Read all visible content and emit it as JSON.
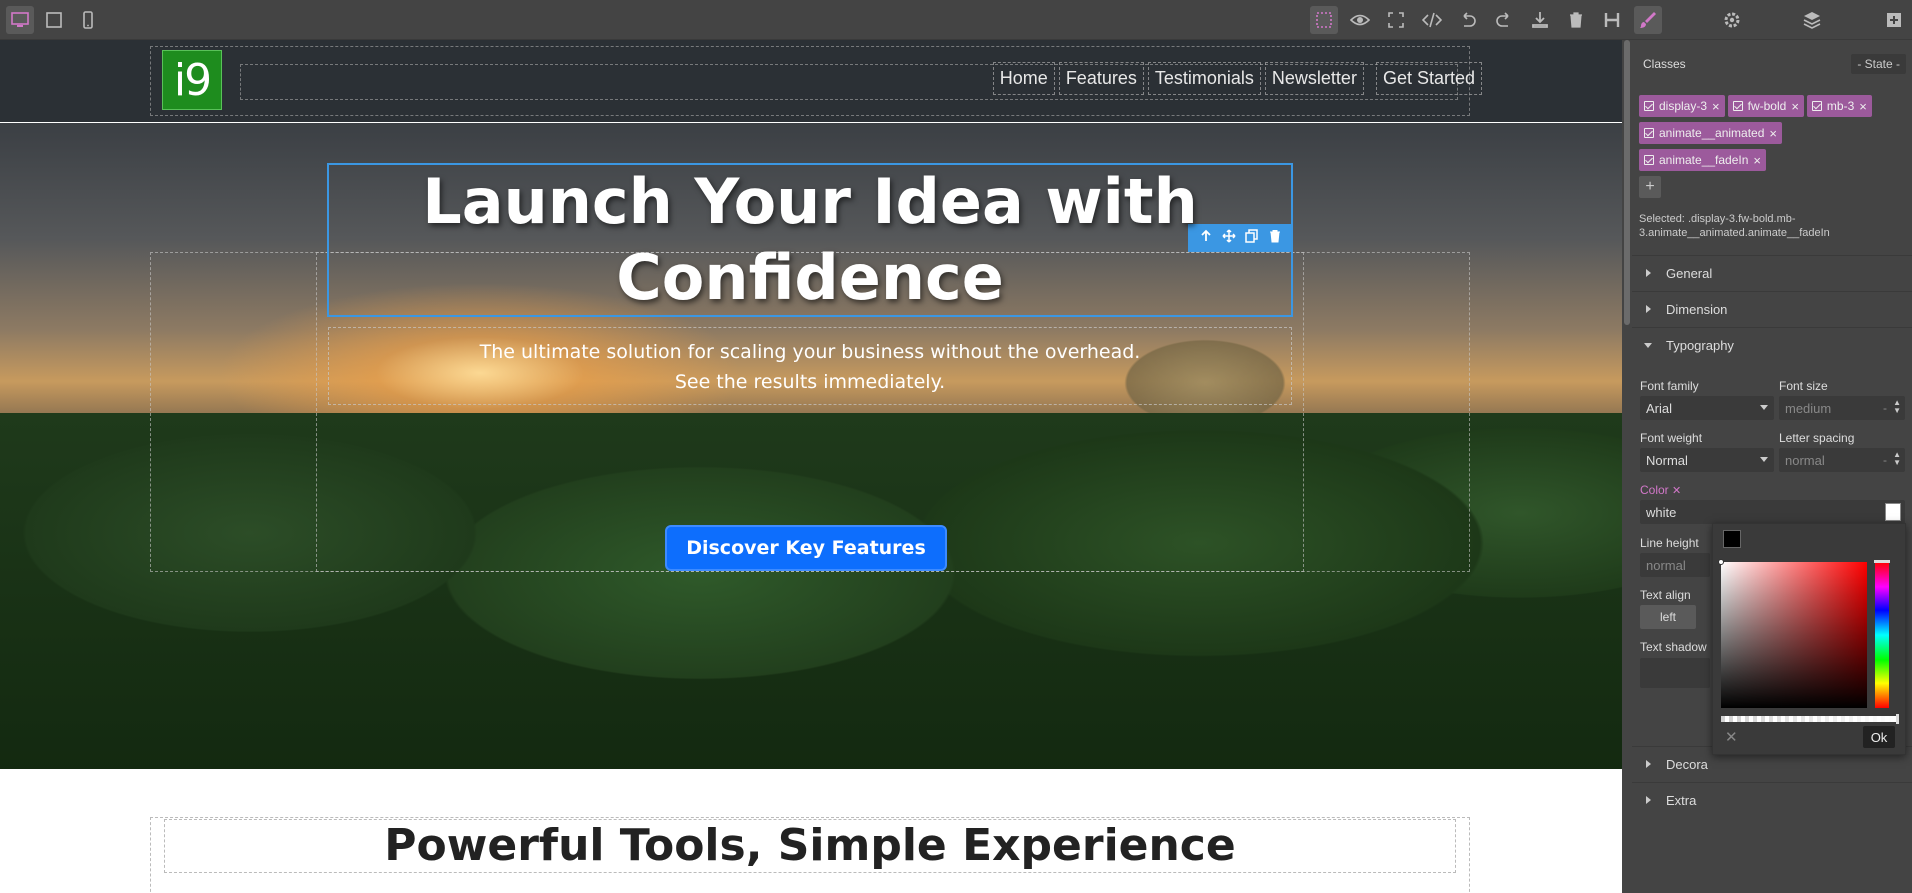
{
  "topbar": {
    "device_buttons": [
      "desktop-icon",
      "tablet-icon",
      "mobile-icon"
    ],
    "action_buttons": [
      "sw-visibility-icon",
      "preview-icon",
      "fullscreen-icon",
      "code-icon",
      "undo-icon",
      "redo-icon",
      "import-icon",
      "trash-icon",
      "heading-icon"
    ],
    "panel_buttons": [
      "style-manager-icon",
      "settings-icon",
      "layers-icon",
      "blocks-icon"
    ],
    "accent_color": "#d278c9"
  },
  "site": {
    "logo_text": "i9",
    "nav": [
      "Home",
      "Features",
      "Testimonials",
      "Newsletter",
      "Get Started"
    ],
    "hero_title": "Launch Your Idea with Confidence",
    "hero_subtitle_line1": "The ultimate solution for scaling your business without the overhead.",
    "hero_subtitle_line2": "See the results immediately.",
    "hero_button": "Discover Key Features",
    "section_title": "Powerful Tools, Simple Experience",
    "button_color": "#0d6efd",
    "selection_color": "#3b97e3"
  },
  "panel": {
    "classes_label": "Classes",
    "state_label": "- State -",
    "tags": [
      "display-3",
      "fw-bold",
      "mb-3",
      "animate__animated",
      "animate__fadeIn"
    ],
    "add_tag": "+",
    "selected_label": "Selected:",
    "selected_value": ".display-3.fw-bold.mb-3.animate__animated.animate__fadeIn",
    "sectors": {
      "general": "General",
      "dimension": "Dimension",
      "typography": "Typography",
      "decorations": "Decora",
      "extra": "Extra"
    },
    "typography": {
      "font_family_label": "Font family",
      "font_family_value": "Arial",
      "font_size_label": "Font size",
      "font_size_placeholder": "medium",
      "font_size_unit": "-",
      "font_weight_label": "Font weight",
      "font_weight_value": "Normal",
      "letter_spacing_label": "Letter spacing",
      "letter_spacing_placeholder": "normal",
      "letter_spacing_unit": "-",
      "color_label": "Color",
      "color_clear": "✕",
      "color_value": "white",
      "line_height_label": "Line height",
      "line_height_placeholder": "normal",
      "text_align_label": "Text align",
      "text_align_value": "left",
      "text_shadow_label": "Text shadow"
    },
    "picker": {
      "ok": "Ok",
      "cancel": "✕"
    }
  }
}
